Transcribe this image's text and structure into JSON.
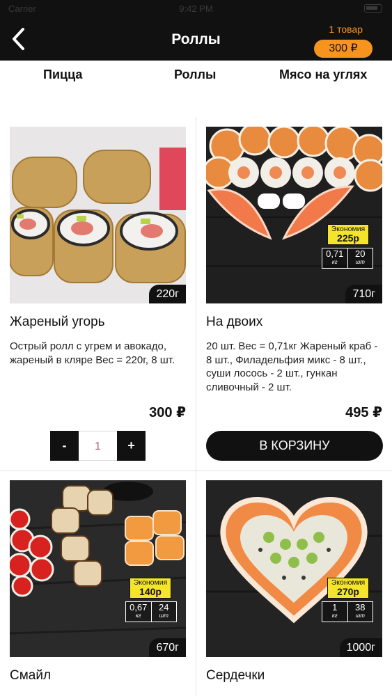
{
  "header": {
    "status_time": "9:42 PM",
    "status_left": "Carrier",
    "title": "Роллы",
    "cart_count": "1 товар",
    "cart_total": "300 ₽"
  },
  "categories": [
    "Пицца",
    "Роллы",
    "Мясо на углях"
  ],
  "products": [
    {
      "name": "Жареный угорь",
      "weight": "220г",
      "description": "Острый ролл с угрем и авокадо, жареный в кляре Вес = 220г, 8 шт.",
      "price": "300 ₽",
      "quantity": "1",
      "qty_minus": "-",
      "qty_plus": "+"
    },
    {
      "name": "На двоих",
      "weight": "710г",
      "description": "20 шт. Вес = 0,71кг Жареный краб - 8 шт., Филадельфия микс - 8 шт., суши лосось - 2 шт., гункан сливочный - 2 шт.",
      "price": "495 ₽",
      "button_label": "В КОРЗИНУ",
      "savings_label": "Экономия",
      "savings_value": "225р",
      "pack_weight": "0,71",
      "pack_weight_unit": "кг",
      "pack_count": "20",
      "pack_count_unit": "шт"
    },
    {
      "name": "Смайл",
      "weight": "670г",
      "savings_label": "Экономия",
      "savings_value": "140р",
      "pack_weight": "0,67",
      "pack_weight_unit": "кг",
      "pack_count": "24",
      "pack_count_unit": "шт"
    },
    {
      "name": "Сердечки",
      "weight": "1000г",
      "savings_label": "Экономия",
      "savings_value": "270р",
      "pack_weight": "1",
      "pack_weight_unit": "кг",
      "pack_count": "38",
      "pack_count_unit": "шт"
    }
  ],
  "colors": {
    "header_bg": "#111111",
    "accent_orange": "#f7941d",
    "savings_yellow": "#f5e52a",
    "button_black": "#111111"
  },
  "icons": {
    "back": "chevron-left-icon"
  }
}
